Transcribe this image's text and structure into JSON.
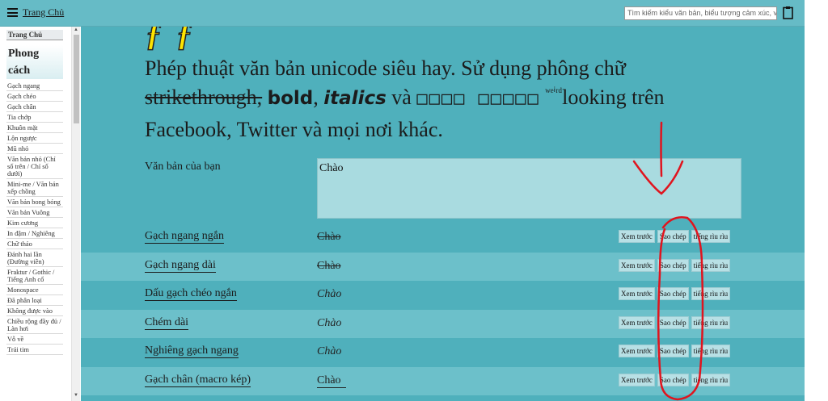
{
  "header": {
    "home_label": "Trang Chủ",
    "search_placeholder": "Tìm kiếm kiểu văn bản, biểu tượng cảm xúc, v"
  },
  "sidebar": {
    "home_label": "Trang Chủ",
    "heading": "Phong cách",
    "items": [
      "Gạch ngang",
      "Gạch chéo",
      "Gạch chân",
      "Tia chớp",
      "Khuôn mặt",
      "Lộn ngược",
      "Mũ nhỏ",
      "Văn bản nhỏ (Chỉ số trên / Chỉ số dưới)",
      "Mini-me / Văn bản xếp chồng",
      "Văn bản bong bóng",
      "Văn bản Vuông",
      "Kim cương",
      "In đậm / Nghiêng",
      "Chữ thảo",
      "Đánh hai lần (Đường viền)",
      "Fraktur / Gothic / Tiếng Anh cổ",
      "Monospace",
      "Đã phân loại",
      "Không được vào",
      "Chiều rộng đầy đủ / Làn hơi",
      "Vỗ về",
      "Trái tim"
    ]
  },
  "intro": {
    "part1": "Phép thuật văn bản unicode siêu hay. Sử dụng phông chữ ",
    "strike": "strikethrough,",
    "bold": "bold",
    "comma": ", ",
    "italic": "italics",
    "and": " và ",
    "boxes": "□□□□ □□□□□",
    "weird": "ʷᵉⁱʳᵈ",
    "part2": "looking trên Facebook, Twitter và mọi nơi khác."
  },
  "input": {
    "label": "Văn bản của bạn",
    "value": "Chào"
  },
  "buttons": {
    "preview": "Xem trước",
    "copy": "Sao chép",
    "weird": "tiếng rìu rìu"
  },
  "rows": [
    {
      "label": "Gạch ngang ngắn",
      "value": "Chào"
    },
    {
      "label": "Gạch ngang dài",
      "value": "Chào"
    },
    {
      "label": "Dấu gạch chéo ngắn",
      "value": "Chào"
    },
    {
      "label": "Chém dài",
      "value": "Chào"
    },
    {
      "label": "Nghiêng gạch ngang",
      "value": "Chào"
    },
    {
      "label": "Gạch chân (macro kép)",
      "value": "Chào"
    }
  ],
  "colors": {
    "topbar": "#66bbc6",
    "main_bg": "#4fb0bc",
    "row_alt": "#6cc0ca",
    "textbox": "#a9dbe0",
    "annotation": "#e0141e"
  }
}
